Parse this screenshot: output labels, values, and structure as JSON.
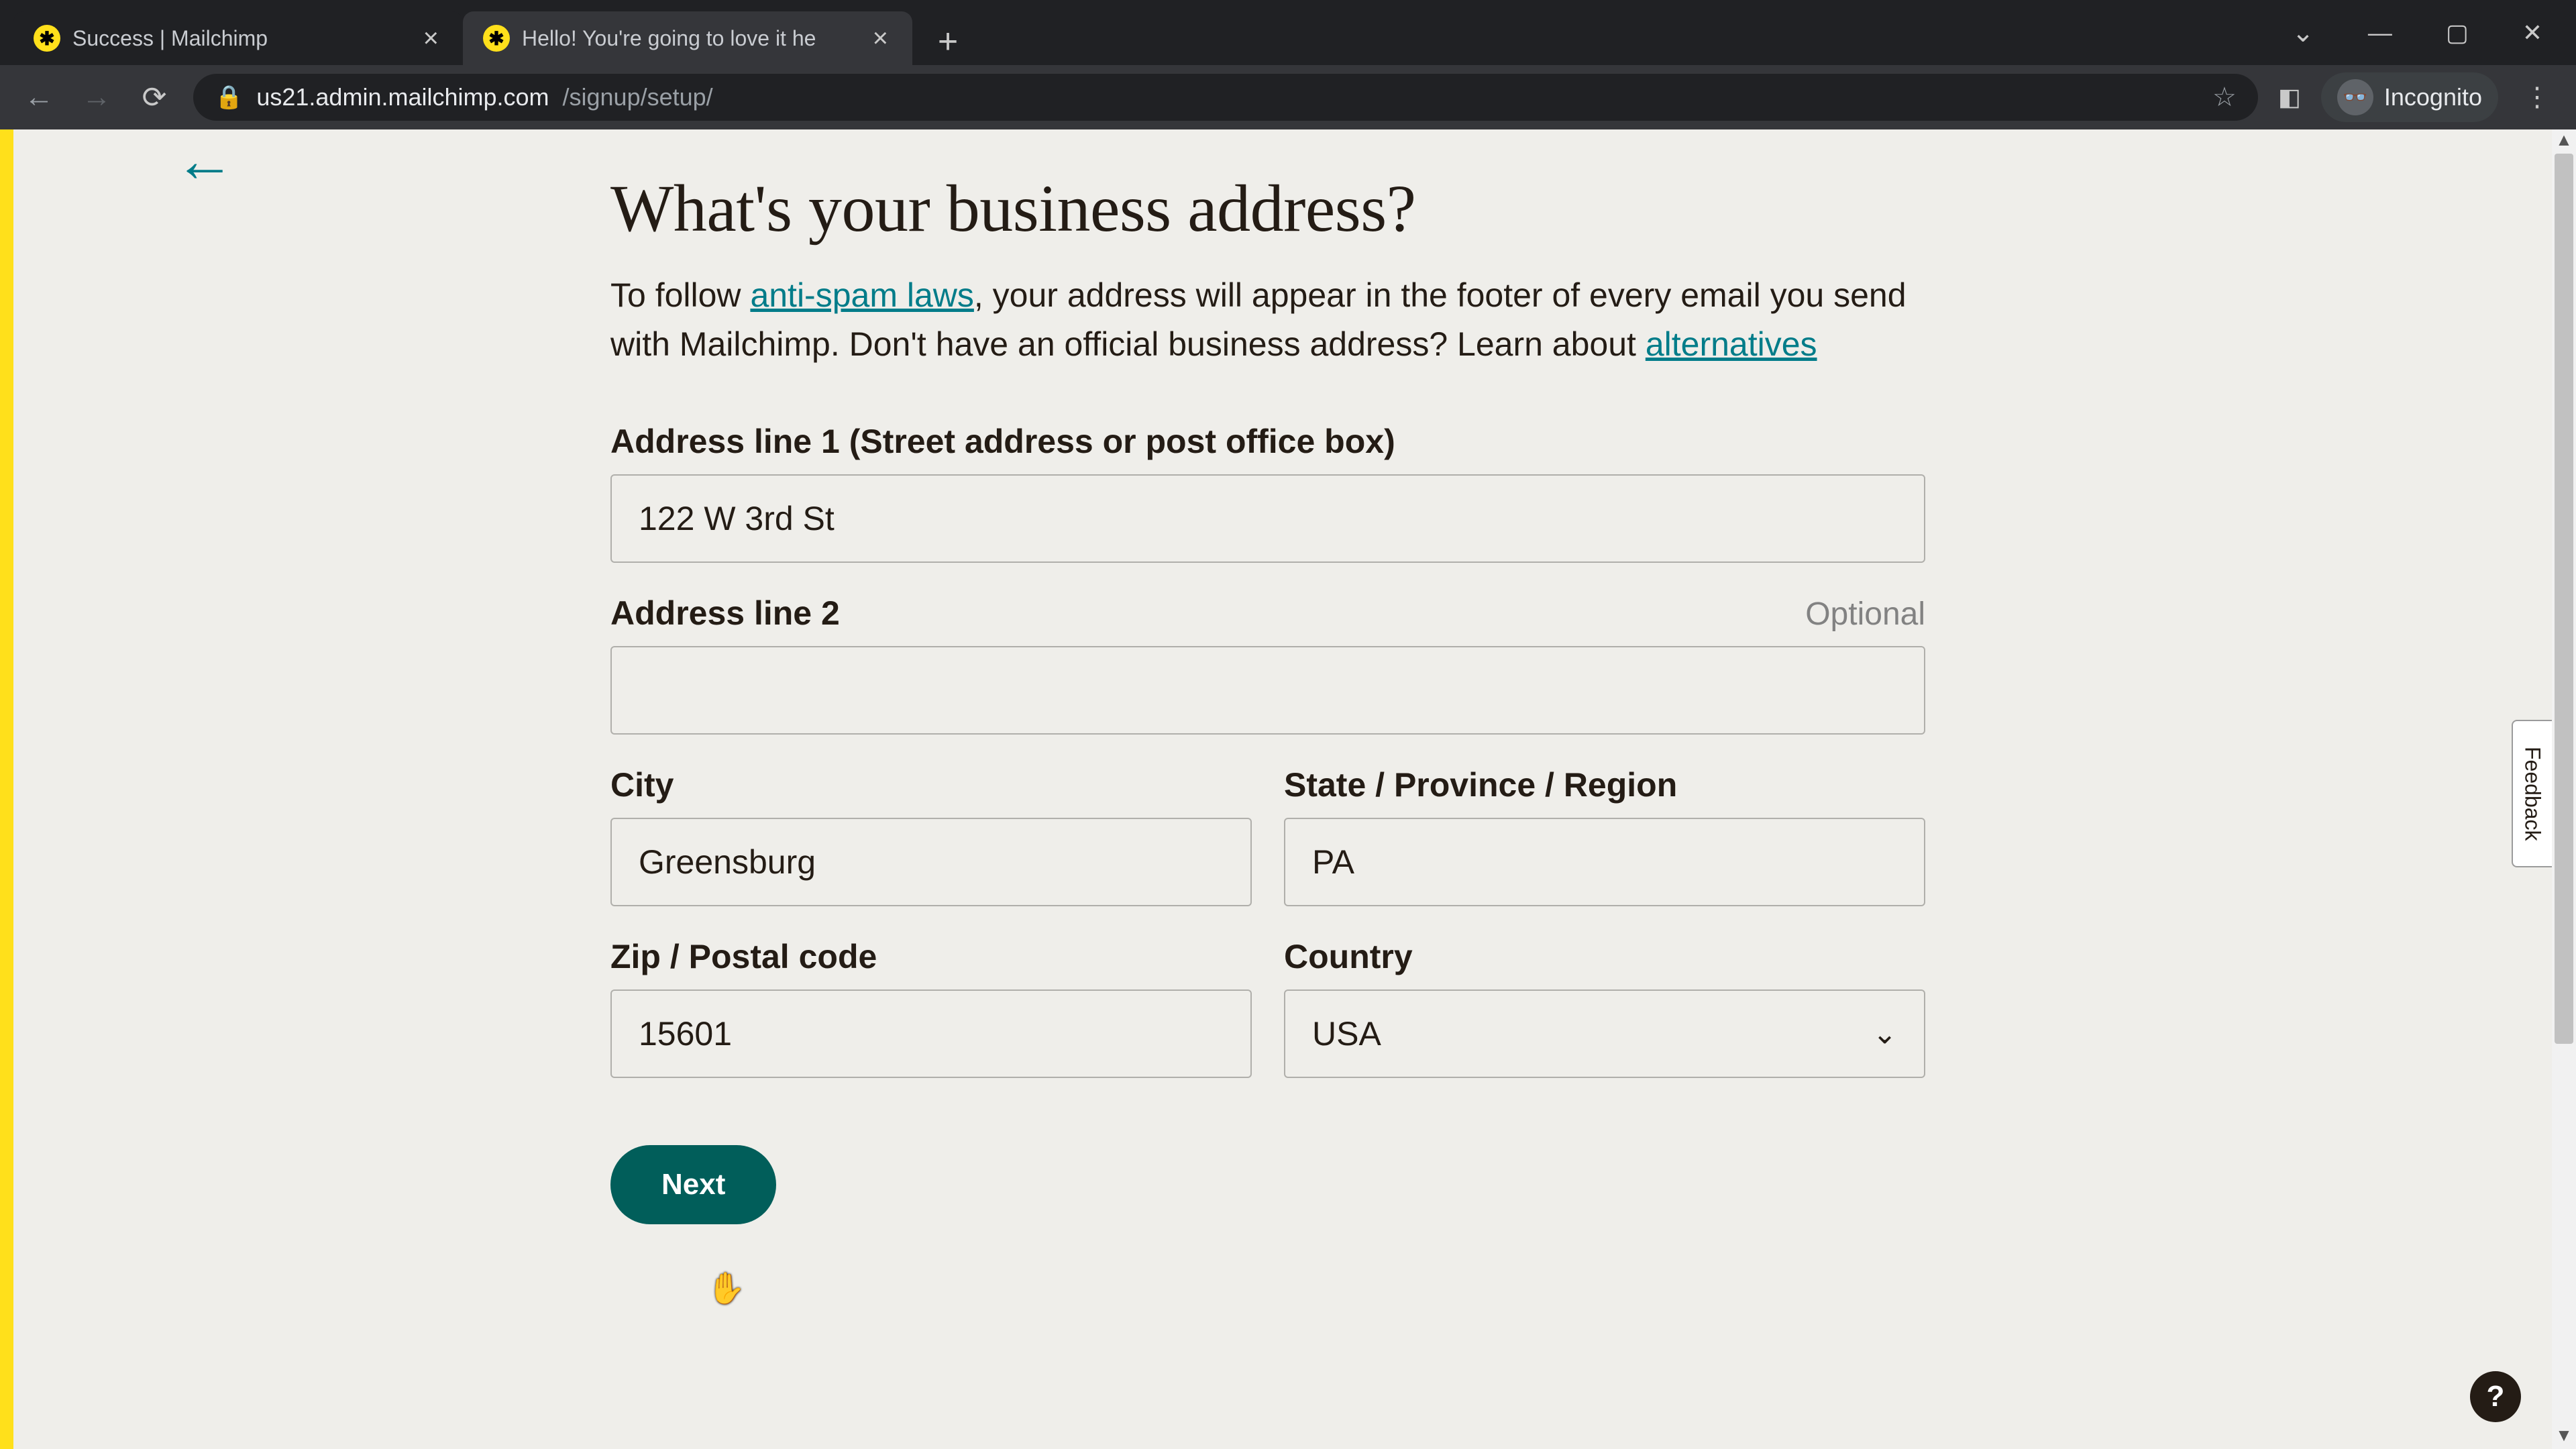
{
  "browser": {
    "tabs": [
      {
        "title": "Success | Mailchimp",
        "active": false
      },
      {
        "title": "Hello! You're going to love it he",
        "active": true
      }
    ],
    "url_host": "us21.admin.mailchimp.com",
    "url_path": "/signup/setup/",
    "incognito_label": "Incognito"
  },
  "page": {
    "title": "What's your business address?",
    "intro_pre": "To follow ",
    "intro_link1": "anti-spam laws",
    "intro_mid": ", your address will appear in the footer of every email you send with Mailchimp. Don't have an official business address? Learn about ",
    "intro_link2": "alternatives",
    "feedback_label": "Feedback",
    "help_label": "?"
  },
  "form": {
    "addr1_label": "Address line 1 (Street address or post office box)",
    "addr1_value": "122 W 3rd St",
    "addr2_label": "Address line 2",
    "addr2_optional": "Optional",
    "addr2_value": "",
    "city_label": "City",
    "city_value": "Greensburg",
    "state_label": "State / Province / Region",
    "state_value": "PA",
    "zip_label": "Zip / Postal code",
    "zip_value": "15601",
    "country_label": "Country",
    "country_value": "USA",
    "next_label": "Next"
  }
}
